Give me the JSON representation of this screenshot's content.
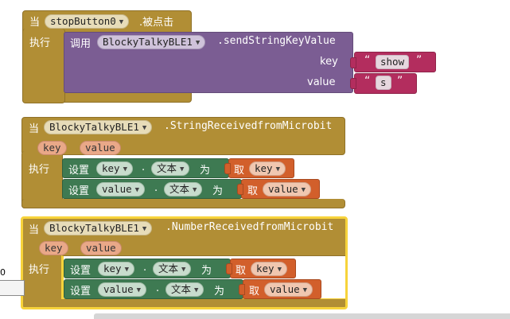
{
  "block1": {
    "when": "当",
    "component": "stopButton0",
    "event": ".被点击",
    "do": "执行",
    "call": "调用",
    "call_component": "BlockyTalkyBLE1",
    "method": ".sendStringKeyValue",
    "key_label": "key",
    "value_label": "value",
    "key_string": "show",
    "value_string": "s"
  },
  "block2": {
    "when": "当",
    "component": "BlockyTalkyBLE1",
    "event": ".StringReceivedfromMicrobit",
    "params": [
      "key",
      "value"
    ],
    "do": "执行",
    "row1": {
      "set": "设置",
      "target": "key",
      "dot": ".",
      "prop": "文本",
      "to": "为",
      "get": "取",
      "var": "key"
    },
    "row2": {
      "set": "设置",
      "target": "value",
      "dot": ".",
      "prop": "文本",
      "to": "为",
      "get": "取",
      "var": "value"
    }
  },
  "block3": {
    "when": "当",
    "component": "BlockyTalkyBLE1",
    "event": ".NumberReceivedfromMicrobit",
    "params": [
      "key",
      "value"
    ],
    "do": "执行",
    "row1": {
      "set": "设置",
      "target": "key",
      "dot": ".",
      "prop": "文本",
      "to": "为",
      "get": "取",
      "var": "key"
    },
    "row2": {
      "set": "设置",
      "target": "value",
      "dot": ".",
      "prop": "文本",
      "to": "为",
      "get": "取",
      "var": "value"
    }
  },
  "side_widget": {
    "value": "0"
  },
  "colors": {
    "event_block": "#b18e35",
    "call_block": "#7b5d93",
    "setter_block": "#3e7a52",
    "getter_block": "#d25f2b",
    "text_block": "#b32d5e",
    "selected_outline": "#f7d33b"
  }
}
